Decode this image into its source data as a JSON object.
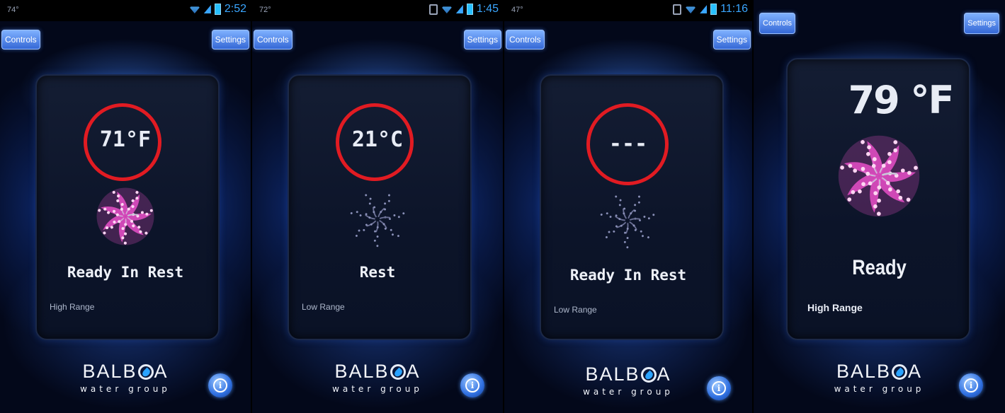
{
  "screens": [
    {
      "status_left": "74°",
      "time": "2:52",
      "controls_label": "Controls",
      "settings_label": "Settings",
      "temperature": "71°F",
      "status": "Ready In Rest",
      "range": "High Range",
      "logo_left": "BALB",
      "logo_right": "A",
      "logo_sub": "water group",
      "info_label": "i"
    },
    {
      "status_left": "72°",
      "time": "1:45",
      "controls_label": "Controls",
      "settings_label": "Settings",
      "temperature": "21°C",
      "status": "Rest",
      "range": "Low Range",
      "logo_left": "BALB",
      "logo_right": "A",
      "logo_sub": "water group",
      "info_label": "i"
    },
    {
      "status_left": "47°",
      "time": "11:16",
      "controls_label": "Controls",
      "settings_label": "Settings",
      "temperature": "---",
      "status": "Ready In Rest",
      "range": "Low Range",
      "logo_left": "BALB",
      "logo_right": "A",
      "logo_sub": "water group",
      "info_label": "i"
    },
    {
      "controls_label": "Controls",
      "settings_label": "Settings",
      "temperature": "79 °F",
      "status": "Ready",
      "range": "High Range",
      "logo_left": "BALB",
      "logo_right": "A",
      "logo_sub": "water group",
      "info_label": "i"
    }
  ],
  "colors": {
    "highlight_ring": "#e11b22",
    "pinwheel_active": "#e84fc8",
    "pinwheel_idle": "#8a90b8",
    "button": "#3568d6"
  }
}
